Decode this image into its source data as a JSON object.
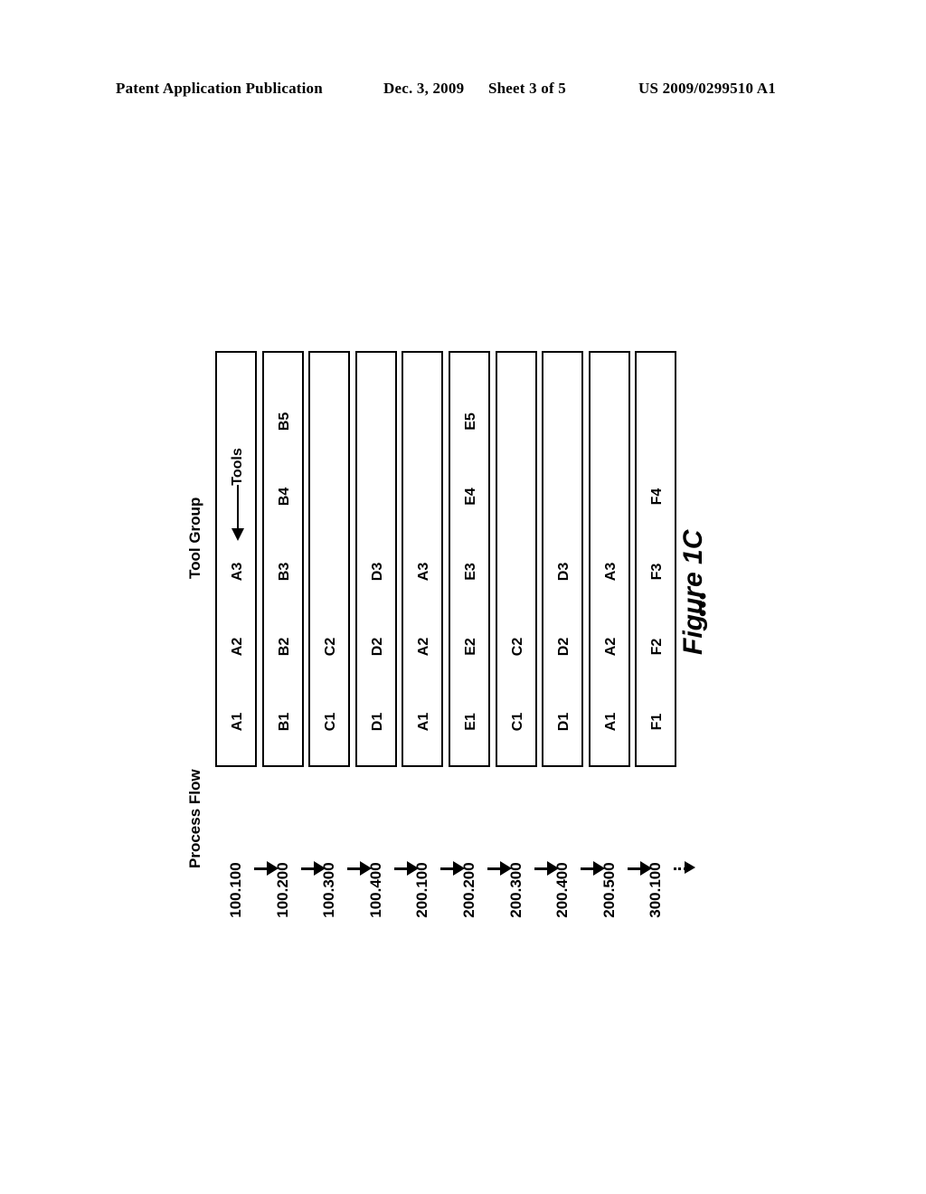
{
  "header": {
    "publication": "Patent Application Publication",
    "date": "Dec. 3, 2009",
    "sheet": "Sheet 3 of 5",
    "patent_number": "US 2009/0299510 A1"
  },
  "figure": {
    "caption": "Figure 1C",
    "tool_group_axis_label": "Tool Group",
    "process_flow_axis_label": "Process Flow",
    "tools_annotation": "Tools",
    "boxes_ellipsis": "•••",
    "tool_groups": [
      {
        "tools": [
          "A1",
          "A2",
          "A3"
        ]
      },
      {
        "tools": [
          "B1",
          "B2",
          "B3",
          "B4",
          "B5"
        ]
      },
      {
        "tools": [
          "C1",
          "C2"
        ]
      },
      {
        "tools": [
          "D1",
          "D2",
          "D3"
        ]
      },
      {
        "tools": [
          "A1",
          "A2",
          "A3"
        ]
      },
      {
        "tools": [
          "E1",
          "E2",
          "E3",
          "E4",
          "E5"
        ]
      },
      {
        "tools": [
          "C1",
          "C2"
        ]
      },
      {
        "tools": [
          "D1",
          "D2",
          "D3"
        ]
      },
      {
        "tools": [
          "A1",
          "A2",
          "A3"
        ]
      },
      {
        "tools": [
          "F1",
          "F2",
          "F3",
          "F4"
        ]
      }
    ],
    "process_flow_steps": [
      "100.100",
      "100.200",
      "100.300",
      "100.400",
      "200.100",
      "200.200",
      "200.300",
      "200.400",
      "200.500",
      "300.100"
    ]
  }
}
